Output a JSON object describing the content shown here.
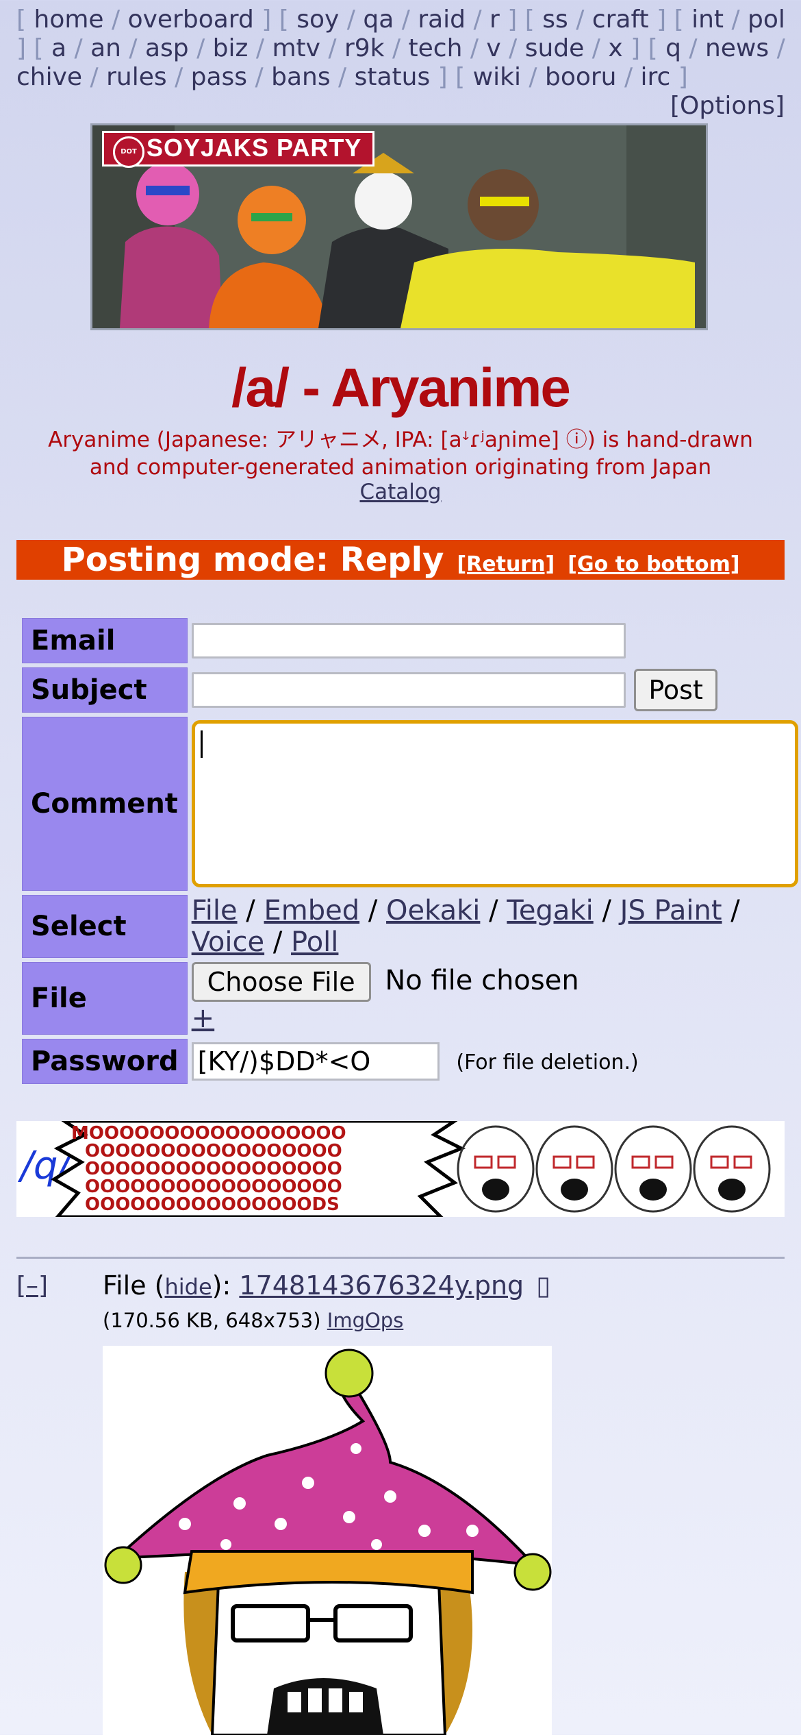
{
  "boardlist": {
    "groups": [
      [
        "home",
        "overboard"
      ],
      [
        "soy",
        "qa",
        "raid",
        "r"
      ],
      [
        "ss",
        "craft"
      ],
      [
        "int",
        "pol"
      ],
      [
        "a",
        "an",
        "asp",
        "biz",
        "mtv",
        "r9k",
        "tech",
        "v",
        "sude",
        "x"
      ],
      [
        "q",
        "news",
        "chive",
        "rules",
        "pass",
        "bans",
        "status"
      ],
      [
        "wiki",
        "booru",
        "irc"
      ]
    ],
    "options": "[Options]"
  },
  "banner": {
    "text": "SOYJAKS PARTY",
    "dot": "DOT"
  },
  "board": {
    "title": "/a/ - Aryanime",
    "subtitle": "Aryanime (Japanese: アリャニメ, IPA: [aꜜɾʲaɲime] ⓘ) is hand-drawn and computer-generated animation originating from Japan",
    "catalog": "Catalog"
  },
  "mode": {
    "label": "Posting mode: Reply",
    "return": "[Return]",
    "bottom": "[Go to bottom]"
  },
  "form": {
    "email_label": "Email",
    "subject_label": "Subject",
    "post_button": "Post",
    "comment_label": "Comment",
    "select_label": "Select",
    "select_options": [
      "File",
      "Embed",
      "Oekaki",
      "Tegaki",
      "JS Paint",
      "Voice",
      "Poll"
    ],
    "file_label": "File",
    "choose_file": "Choose File",
    "no_file": "No file chosen",
    "add_file": "+",
    "password_label": "Password",
    "password_value": "[KY/)$DD*<O",
    "password_note": "(For file deletion.)"
  },
  "ad": {
    "q_text": "/q/",
    "moo": "MOOOOOOOOOOOOOOOOOOOOOOOOOOOOOOOOOOOOOOOOOOOOOOOOOOOOOOOOOOOOOOOOOOOOOOOOOOOOOOOOODS"
  },
  "post": {
    "toggle": "[–]",
    "file_prefix": "File (",
    "hide": "hide",
    "file_suffix": "): ",
    "filename": "1748143676324y.png",
    "file_icon": "▯",
    "meta": "(170.56 KB, 648x753)",
    "imgops": "ImgOps"
  },
  "colors": {
    "title": "#af0a0f",
    "mode_bar": "#e04000",
    "form_label": "#9988ee",
    "focus": "#e0a000"
  }
}
